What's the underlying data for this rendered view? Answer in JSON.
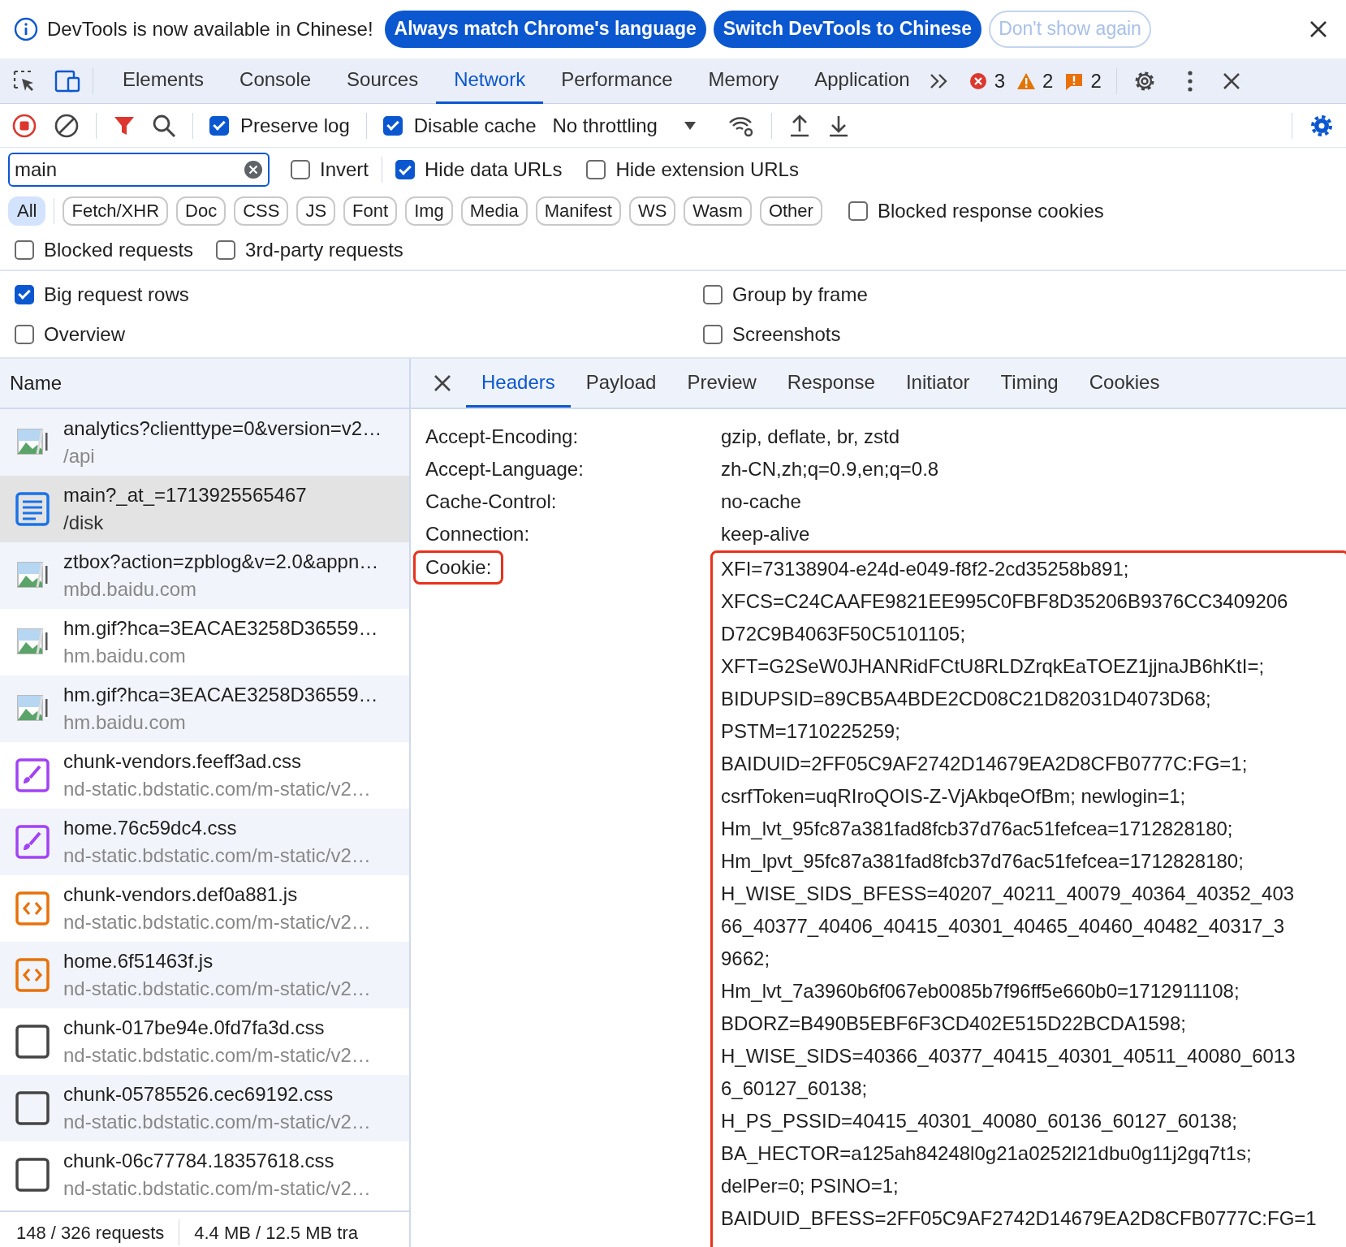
{
  "infobar": {
    "message": "DevTools is now available in Chinese!",
    "buttons": [
      {
        "label": "Always match Chrome's language",
        "kind": "primary"
      },
      {
        "label": "Switch DevTools to Chinese",
        "kind": "primary"
      },
      {
        "label": "Don't show again",
        "kind": "outline"
      }
    ]
  },
  "main_tabs": [
    {
      "label": "Elements",
      "selected": false
    },
    {
      "label": "Console",
      "selected": false
    },
    {
      "label": "Sources",
      "selected": false
    },
    {
      "label": "Network",
      "selected": true
    },
    {
      "label": "Performance",
      "selected": false
    },
    {
      "label": "Memory",
      "selected": false
    },
    {
      "label": "Application",
      "selected": false
    }
  ],
  "issues": [
    {
      "kind": "error",
      "count": "3"
    },
    {
      "kind": "warning",
      "count": "2"
    },
    {
      "kind": "info",
      "count": "2"
    }
  ],
  "toolbar": {
    "preserve_log": {
      "label": "Preserve log",
      "checked": true
    },
    "disable_cache": {
      "label": "Disable cache",
      "checked": true
    },
    "throttling": "No throttling"
  },
  "filter": {
    "value": "main",
    "invert": {
      "label": "Invert",
      "checked": false
    },
    "hide_data_urls": {
      "label": "Hide data URLs",
      "checked": true
    },
    "hide_extension_urls": {
      "label": "Hide extension URLs",
      "checked": false
    }
  },
  "type_filters": [
    {
      "label": "All",
      "selected": true
    },
    {
      "label": "Fetch/XHR",
      "selected": false
    },
    {
      "label": "Doc",
      "selected": false
    },
    {
      "label": "CSS",
      "selected": false
    },
    {
      "label": "JS",
      "selected": false
    },
    {
      "label": "Font",
      "selected": false
    },
    {
      "label": "Img",
      "selected": false
    },
    {
      "label": "Media",
      "selected": false
    },
    {
      "label": "Manifest",
      "selected": false
    },
    {
      "label": "WS",
      "selected": false
    },
    {
      "label": "Wasm",
      "selected": false
    },
    {
      "label": "Other",
      "selected": false
    }
  ],
  "blocked_response_cookies": {
    "label": "Blocked response cookies",
    "checked": false
  },
  "more_filters": [
    {
      "label": "Blocked requests",
      "checked": false
    },
    {
      "label": "3rd-party requests",
      "checked": false
    }
  ],
  "settings": [
    {
      "label": "Big request rows",
      "checked": true
    },
    {
      "label": "Group by frame",
      "checked": false
    },
    {
      "label": "Overview",
      "checked": false
    },
    {
      "label": "Screenshots",
      "checked": false
    }
  ],
  "requests": {
    "column": "Name",
    "rows": [
      {
        "name": "analytics?clienttype=0&version=v2…",
        "domain": "/api",
        "kind": "image",
        "selected": false
      },
      {
        "name": "main?_at_=1713925565467",
        "domain": "/disk",
        "kind": "document",
        "selected": true
      },
      {
        "name": "ztbox?action=zpblog&v=2.0&appn…",
        "domain": "mbd.baidu.com",
        "kind": "image",
        "selected": false
      },
      {
        "name": "hm.gif?hca=3EACAE3258D36559…",
        "domain": "hm.baidu.com",
        "kind": "image",
        "selected": false
      },
      {
        "name": "hm.gif?hca=3EACAE3258D36559…",
        "domain": "hm.baidu.com",
        "kind": "image",
        "selected": false
      },
      {
        "name": "chunk-vendors.feeff3ad.css",
        "domain": "nd-static.bdstatic.com/m-static/v2…",
        "kind": "stylesheet",
        "selected": false
      },
      {
        "name": "home.76c59dc4.css",
        "domain": "nd-static.bdstatic.com/m-static/v2…",
        "kind": "stylesheet",
        "selected": false
      },
      {
        "name": "chunk-vendors.def0a881.js",
        "domain": "nd-static.bdstatic.com/m-static/v2…",
        "kind": "script",
        "selected": false
      },
      {
        "name": "home.6f51463f.js",
        "domain": "nd-static.bdstatic.com/m-static/v2…",
        "kind": "script",
        "selected": false
      },
      {
        "name": "chunk-017be94e.0fd7fa3d.css",
        "domain": "nd-static.bdstatic.com/m-static/v2…",
        "kind": "other",
        "selected": false
      },
      {
        "name": "chunk-05785526.cec69192.css",
        "domain": "nd-static.bdstatic.com/m-static/v2…",
        "kind": "other",
        "selected": false
      },
      {
        "name": "chunk-06c77784.18357618.css",
        "domain": "nd-static.bdstatic.com/m-static/v2…",
        "kind": "other",
        "selected": false
      }
    ]
  },
  "status_bar": [
    "148 / 326 requests",
    "4.4 MB / 12.5 MB tra"
  ],
  "detail": {
    "tabs": [
      {
        "label": "Headers",
        "selected": true
      },
      {
        "label": "Payload",
        "selected": false
      },
      {
        "label": "Preview",
        "selected": false
      },
      {
        "label": "Response",
        "selected": false
      },
      {
        "label": "Initiator",
        "selected": false
      },
      {
        "label": "Timing",
        "selected": false
      },
      {
        "label": "Cookies",
        "selected": false
      }
    ],
    "headers": [
      {
        "name": "Accept-Encoding:",
        "value_lines": [
          "gzip, deflate, br, zstd"
        ],
        "highlighted": false
      },
      {
        "name": "Accept-Language:",
        "value_lines": [
          "zh-CN,zh;q=0.9,en;q=0.8"
        ],
        "highlighted": false
      },
      {
        "name": "Cache-Control:",
        "value_lines": [
          "no-cache"
        ],
        "highlighted": false
      },
      {
        "name": "Connection:",
        "value_lines": [
          "keep-alive"
        ],
        "highlighted": false
      },
      {
        "name": "Cookie:",
        "highlighted": true,
        "value_lines": [
          "XFI=73138904-e24d-e049-f8f2-2cd35258b891;",
          "XFCS=C24CAAFE9821EE995C0FBF8D35206B9376CC3409206",
          "D72C9B4063F50C5101105;",
          "XFT=G2SeW0JHANRidFCtU8RLDZrqkEaTOEZ1jjnaJB6hKtI=;",
          "BIDUPSID=89CB5A4BDE2CD08C21D82031D4073D68;",
          "PSTM=1710225259;",
          "BAIDUID=2FF05C9AF2742D14679EA2D8CFB0777C:FG=1;",
          "csrfToken=uqRIroQOIS-Z-VjAkbqeOfBm; newlogin=1;",
          "Hm_lvt_95fc87a381fad8fcb37d76ac51fefcea=1712828180;",
          "Hm_lpvt_95fc87a381fad8fcb37d76ac51fefcea=1712828180;",
          "H_WISE_SIDS_BFESS=40207_40211_40079_40364_40352_403",
          "66_40377_40406_40415_40301_40465_40460_40482_40317_3",
          "9662;",
          "Hm_lvt_7a3960b6f067eb0085b7f96ff5e660b0=1712911108;",
          "BDORZ=B490B5EBF6F3CD402E515D22BCDA1598;",
          "H_WISE_SIDS=40366_40377_40415_40301_40511_40080_6013",
          "6_60127_60138;",
          "H_PS_PSSID=40415_40301_40080_60136_60127_60138;",
          "BA_HECTOR=a125ah84248l0g21a0252l21dbu0g11j2gq7t1s;",
          "delPer=0; PSINO=1;",
          "BAIDUID_BFESS=2FF05C9AF2742D14679EA2D8CFB0777C:FG=1"
        ]
      }
    ]
  }
}
